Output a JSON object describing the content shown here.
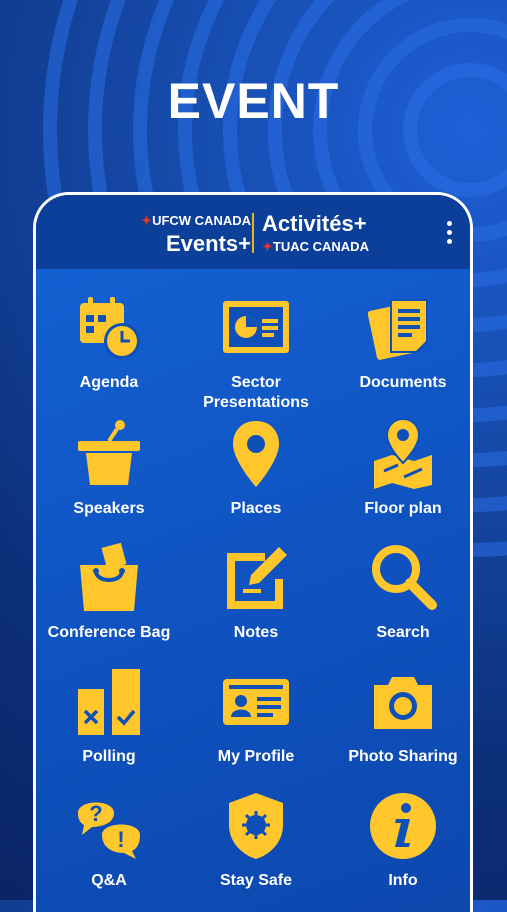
{
  "hero": {
    "title": "EVENT"
  },
  "app": {
    "logo_left_top": "UFCW CANADA",
    "logo_left_main": "Events+",
    "logo_right_main": "Activités+",
    "logo_right_bottom": "TUAC CANADA",
    "logo_maple_glyph": "✦",
    "menu_icon": "more-vert-icon"
  },
  "colors": {
    "accent": "#FFC72C",
    "brand_blue": "#0E4FB8",
    "appbar": "#0B3F9A"
  },
  "tiles": [
    {
      "label": "Agenda",
      "icon": "calendar-clock-icon"
    },
    {
      "label": "Sector Presentations",
      "icon": "presentation-icon"
    },
    {
      "label": "Documents",
      "icon": "documents-icon"
    },
    {
      "label": "Speakers",
      "icon": "podium-icon"
    },
    {
      "label": "Places",
      "icon": "map-pin-icon"
    },
    {
      "label": "Floor plan",
      "icon": "floor-plan-map-icon"
    },
    {
      "label": "Conference Bag",
      "icon": "shopping-bag-icon"
    },
    {
      "label": "Notes",
      "icon": "edit-notes-icon"
    },
    {
      "label": "Search",
      "icon": "magnifier-icon"
    },
    {
      "label": "Polling",
      "icon": "poll-chart-icon"
    },
    {
      "label": "My Profile",
      "icon": "id-card-icon"
    },
    {
      "label": "Photo Sharing",
      "icon": "camera-icon"
    },
    {
      "label": "Q&A",
      "icon": "question-exclamation-icon"
    },
    {
      "label": "Stay Safe",
      "icon": "virus-shield-icon"
    },
    {
      "label": "Info",
      "icon": "info-icon"
    }
  ]
}
